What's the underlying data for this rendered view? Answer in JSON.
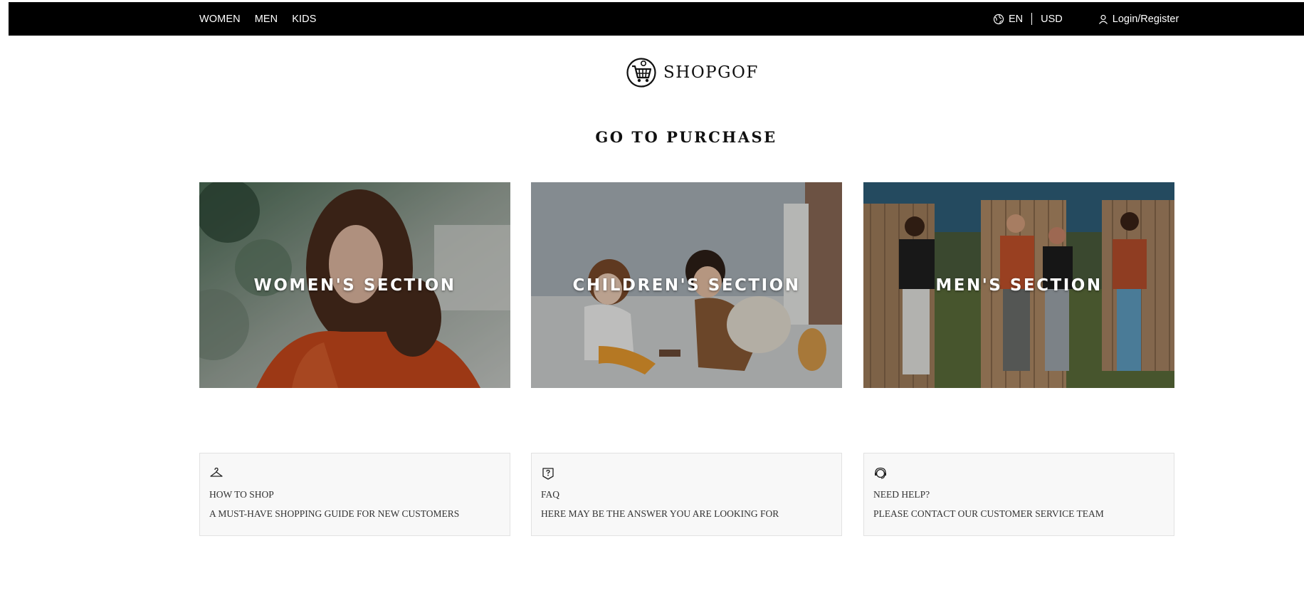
{
  "topbar": {
    "nav": [
      "WOMEN",
      "MEN",
      "KIDS"
    ],
    "language": "EN",
    "currency": "USD",
    "login": "Login/Register"
  },
  "logo": {
    "text": "SHOPGOF",
    "icon": "shopping-cart-logo-icon"
  },
  "heading": "GO TO PURCHASE",
  "sections": [
    {
      "label": "WOMEN'S SECTION",
      "image": "woman-orange-coat-photo"
    },
    {
      "label": "CHILDREN'S SECTION",
      "image": "children-playing-photo"
    },
    {
      "label": "MEN'S SECTION",
      "image": "men-fence-photo"
    }
  ],
  "info": [
    {
      "icon": "hanger-icon",
      "title": "HOW TO SHOP",
      "text": "A MUST-HAVE SHOPPING GUIDE FOR NEW CUSTOMERS"
    },
    {
      "icon": "question-icon",
      "title": "FAQ",
      "text": "HERE MAY BE THE ANSWER YOU ARE LOOKING FOR"
    },
    {
      "icon": "headset-icon",
      "title": "NEED HELP?",
      "text": "PLEASE CONTACT OUR CUSTOMER SERVICE TEAM"
    }
  ],
  "colors": {
    "topbar": "#000000",
    "info_bg": "#f8f8f8"
  }
}
